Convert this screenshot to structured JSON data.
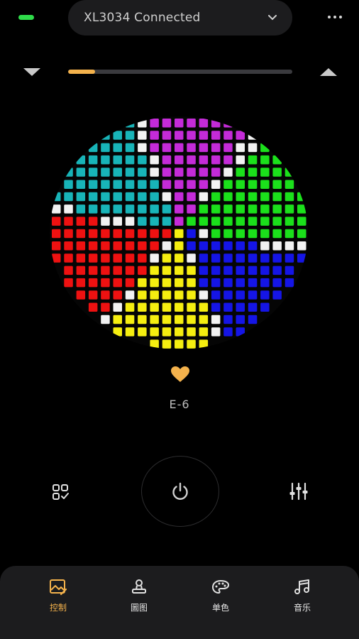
{
  "header": {
    "device_label": "XL3034 Connected",
    "status_color": "#2fdc4a"
  },
  "brightness": {
    "level_percent": 12,
    "accent": "#f4b24c"
  },
  "matrix": {
    "colors": {
      "cyan": "#18b4b8",
      "magenta": "#c42bd8",
      "green": "#1be01b",
      "blue": "#1515e6",
      "yellow": "#f5ee10",
      "red": "#ee1111",
      "white": "#f2f2f2"
    }
  },
  "effect": {
    "name": "E-6",
    "favorite_color": "#f4b24c"
  },
  "controls": {
    "left_icon": "grid-select-icon",
    "center_icon": "power-icon",
    "right_icon": "sliders-icon"
  },
  "tabs": [
    {
      "label": "控制",
      "icon": "image-edit-icon",
      "active": true
    },
    {
      "label": "圖图",
      "icon": "stamp-icon",
      "active": false
    },
    {
      "label": "单色",
      "icon": "palette-icon",
      "active": false
    },
    {
      "label": "音乐",
      "icon": "music-icon",
      "active": false
    }
  ]
}
